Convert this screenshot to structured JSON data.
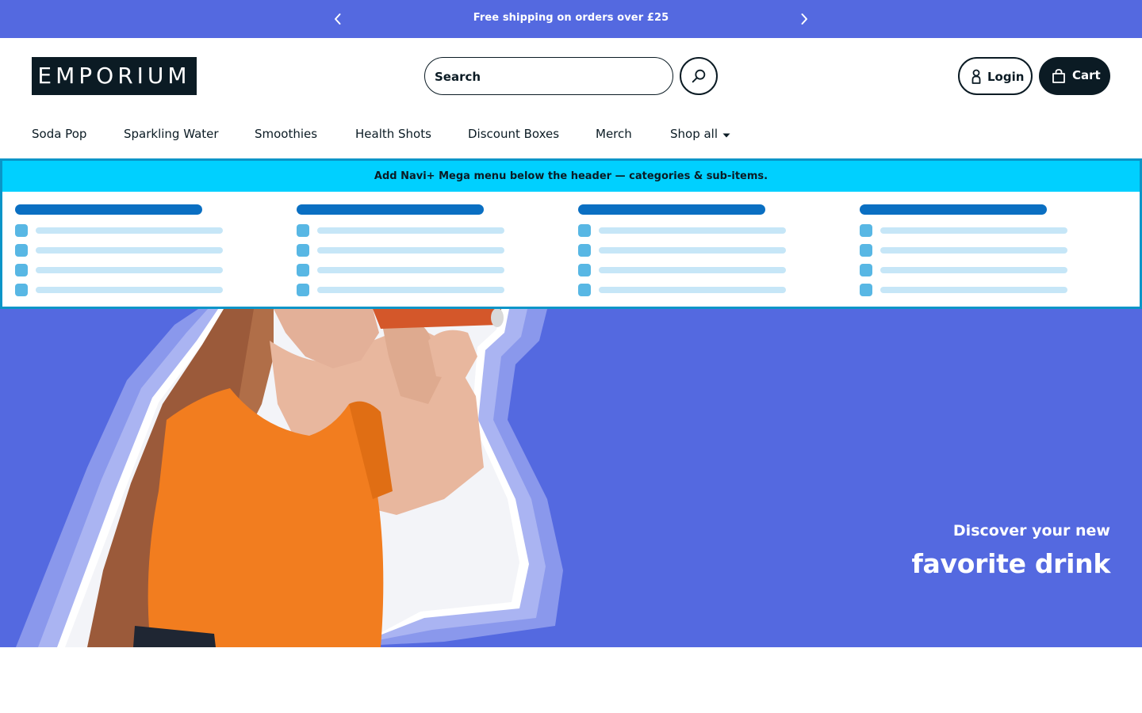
{
  "announcement": {
    "text": "Free shipping on orders over £25",
    "prev_icon": "chevron-left-icon",
    "next_icon": "chevron-right-icon"
  },
  "header": {
    "logo_text": "EMPORIUM",
    "search": {
      "placeholder": "Search",
      "button_icon": "search-icon"
    },
    "login_label": "Login",
    "cart_label": "Cart"
  },
  "nav": {
    "items": [
      {
        "label": "Soda Pop"
      },
      {
        "label": "Sparkling Water"
      },
      {
        "label": "Smoothies"
      },
      {
        "label": "Health Shots"
      },
      {
        "label": "Discount Boxes"
      },
      {
        "label": "Merch"
      },
      {
        "label": "Shop all",
        "dropdown": true
      }
    ]
  },
  "mega_menu": {
    "banner_text": "Add Navi+ Mega menu below the header — categories & sub-items."
  },
  "hero": {
    "subtitle": "Discover your new",
    "title": "favorite drink"
  },
  "colors": {
    "brand_blue": "#5469e0",
    "dark": "#0b1b24",
    "mega_banner": "#00d0ff",
    "mega_border": "#0a95c8"
  }
}
